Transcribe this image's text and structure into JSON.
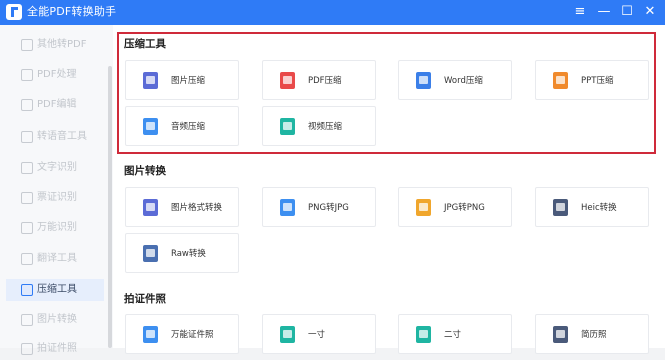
{
  "app": {
    "title": "全能PDF转换助手"
  },
  "window_controls": [
    "≡",
    "—",
    "☐",
    "✕"
  ],
  "sidebar": {
    "items": [
      {
        "label": "其他转PDF",
        "active": false
      },
      {
        "label": "PDF处理",
        "active": false
      },
      {
        "label": "PDF编辑",
        "active": false
      },
      {
        "label": "转语音工具",
        "active": false
      },
      {
        "label": "文字识别",
        "active": false
      },
      {
        "label": "票证识别",
        "active": false
      },
      {
        "label": "万能识别",
        "active": false
      },
      {
        "label": "翻译工具",
        "active": false
      },
      {
        "label": "压缩工具",
        "active": true
      },
      {
        "label": "图片转换",
        "active": false
      },
      {
        "label": "拍证件照",
        "active": false
      }
    ]
  },
  "sections": {
    "compress": {
      "title": "压缩工具",
      "cards": [
        {
          "label": "图片压缩",
          "icon": "image-icon",
          "color": "#5b6bd6"
        },
        {
          "label": "PDF压缩",
          "icon": "pdf-icon",
          "color": "#e94a4a"
        },
        {
          "label": "Word压缩",
          "icon": "word-icon",
          "color": "#3b7fe8"
        },
        {
          "label": "PPT压缩",
          "icon": "ppt-icon",
          "color": "#f08a2c"
        },
        {
          "label": "音频压缩",
          "icon": "audio-icon",
          "color": "#3d8ff0"
        },
        {
          "label": "视频压缩",
          "icon": "video-icon",
          "color": "#1fb5a2"
        }
      ]
    },
    "image_convert": {
      "title": "图片转换",
      "cards": [
        {
          "label": "图片格式转换",
          "icon": "image-format-icon",
          "color": "#5b6bd6"
        },
        {
          "label": "PNG转JPG",
          "icon": "png-icon",
          "color": "#3d8ff0"
        },
        {
          "label": "JPG转PNG",
          "icon": "jpg-icon",
          "color": "#f0a62c"
        },
        {
          "label": "Heic转换",
          "icon": "heic-icon",
          "color": "#4a5a7a"
        },
        {
          "label": "Raw转换",
          "icon": "raw-icon",
          "color": "#4a6fb0"
        }
      ]
    },
    "id_photo": {
      "title": "拍证件照",
      "cards": [
        {
          "label": "万能证件照",
          "icon": "id-photo-icon",
          "color": "#3d8ff0"
        },
        {
          "label": "一寸",
          "icon": "one-inch-icon",
          "color": "#1fb5a2"
        },
        {
          "label": "二寸",
          "icon": "two-inch-icon",
          "color": "#1fb5a2"
        },
        {
          "label": "简历照",
          "icon": "resume-photo-icon",
          "color": "#4a5a7a"
        }
      ]
    }
  }
}
